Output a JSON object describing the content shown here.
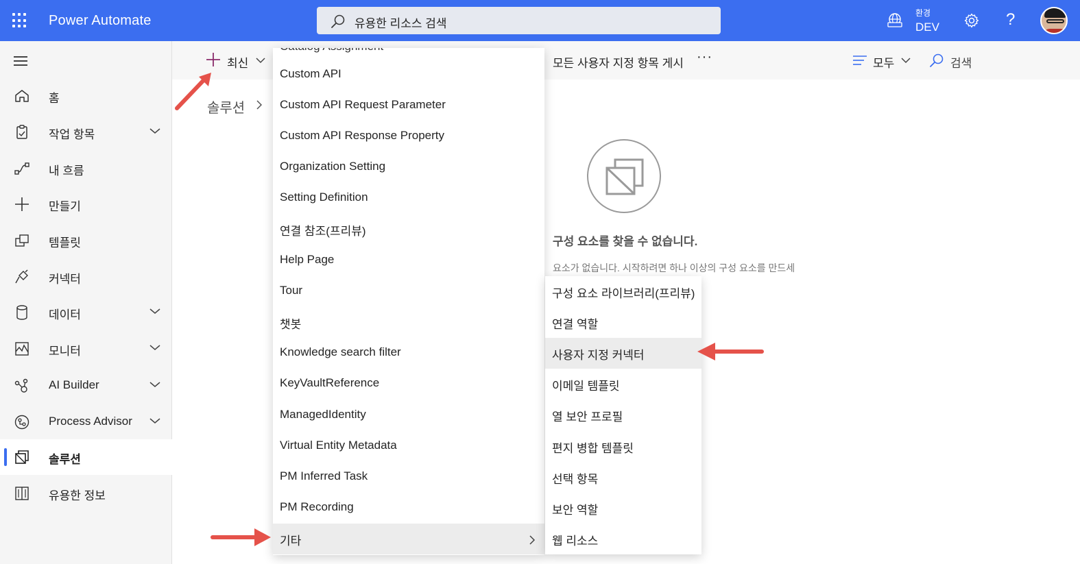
{
  "header": {
    "app_title": "Power Automate",
    "search_placeholder": "유용한 리소스 검색",
    "environment_label": "환경",
    "environment_name": "DEV",
    "help_glyph": "?"
  },
  "sidebar": {
    "items": [
      {
        "label": "홈",
        "icon": "home-icon"
      },
      {
        "label": "작업 항목",
        "icon": "clipboard-icon",
        "expandable": true
      },
      {
        "label": "내 흐름",
        "icon": "flow-icon"
      },
      {
        "label": "만들기",
        "icon": "plus-icon"
      },
      {
        "label": "템플릿",
        "icon": "template-icon"
      },
      {
        "label": "커넥터",
        "icon": "connector-icon"
      },
      {
        "label": "데이터",
        "icon": "database-icon",
        "expandable": true
      },
      {
        "label": "모니터",
        "icon": "monitor-icon",
        "expandable": true
      },
      {
        "label": "AI Builder",
        "icon": "ai-builder-icon",
        "expandable": true
      },
      {
        "label": "Process Advisor",
        "icon": "process-advisor-icon",
        "expandable": true
      },
      {
        "label": "솔루션",
        "icon": "solution-icon",
        "active": true
      },
      {
        "label": "유용한 정보",
        "icon": "book-icon"
      }
    ]
  },
  "command_bar": {
    "new_label": "최신",
    "show_all_label": "모든 사용자 지정 항목 게시",
    "more_label": "···",
    "filter_label": "모두",
    "search_label": "검색"
  },
  "breadcrumb": {
    "label": "솔루션"
  },
  "empty_state": {
    "title": "구성 요소를 찾을 수 없습니다.",
    "subtitle": "요소가 없습니다. 시작하려면 하나 이상의 구성 요소를 만드세"
  },
  "menu": {
    "cut_item": "Catalog Assignment",
    "items": [
      "Custom API",
      "Custom API Request Parameter",
      "Custom API Response Property",
      "Organization Setting",
      "Setting Definition",
      "연결 참조(프리뷰)",
      "Help Page",
      "Tour",
      "챗봇",
      "Knowledge search filter",
      "KeyVaultReference",
      "ManagedIdentity",
      "Virtual Entity Metadata",
      "PM Inferred Task",
      "PM Recording",
      "기타"
    ]
  },
  "submenu": {
    "items": [
      "구성 요소 라이브러리(프리뷰)",
      "연결 역할",
      "사용자 지정 커넥터",
      "이메일 템플릿",
      "열 보안 프로필",
      "편지 병합 템플릿",
      "선택 항목",
      "보안 역할",
      "웹 리소스"
    ]
  },
  "colors": {
    "brand": "#3b6ef0",
    "annotation_arrow": "#e5524a"
  }
}
